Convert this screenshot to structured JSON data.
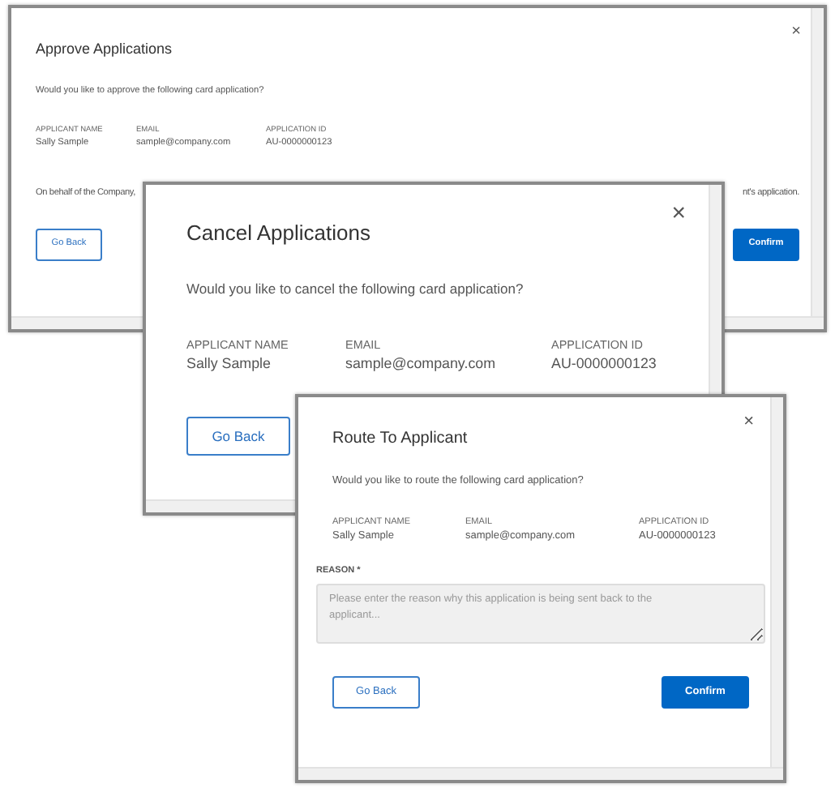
{
  "dialogs": [
    {
      "title": "Approve Applications",
      "close": "×",
      "question": "Would you like to approve the following card application?",
      "fields": [
        {
          "label": "APPLICANT NAME",
          "value": "Sally Sample"
        },
        {
          "label": "EMAIL",
          "value": "sample@company.com"
        },
        {
          "label": "APPLICATION ID",
          "value": "AU-0000000123"
        }
      ],
      "note_start": "On behalf of the Company,",
      "note_end": "nt's application.",
      "buttons": [
        {
          "label": "Go Back",
          "kind": "secondary"
        },
        {
          "label": "Confirm",
          "kind": "primary"
        }
      ]
    },
    {
      "title": "Cancel Applications",
      "close": "×",
      "question": "Would you like to cancel the following card application?",
      "fields": [
        {
          "label": "APPLICANT NAME",
          "value": "Sally Sample"
        },
        {
          "label": "EMAIL",
          "value": "sample@company.com"
        },
        {
          "label": "APPLICATION ID",
          "value": "AU-0000000123"
        }
      ],
      "buttons": [
        {
          "label": "Go Back",
          "kind": "secondary"
        }
      ]
    },
    {
      "title": "Route To Applicant",
      "close": "×",
      "question": "Would you like to route the following card application?",
      "fields": [
        {
          "label": "APPLICANT NAME",
          "value": "Sally Sample"
        },
        {
          "label": "EMAIL",
          "value": "sample@company.com"
        },
        {
          "label": "APPLICATION ID",
          "value": "AU-0000000123"
        }
      ],
      "reason": {
        "label": "REASON *",
        "placeholder": "Please enter the reason why this application is being sent back to the applicant..."
      },
      "buttons": [
        {
          "label": "Go Back",
          "kind": "secondary"
        },
        {
          "label": "Confirm",
          "kind": "primary"
        }
      ]
    }
  ]
}
